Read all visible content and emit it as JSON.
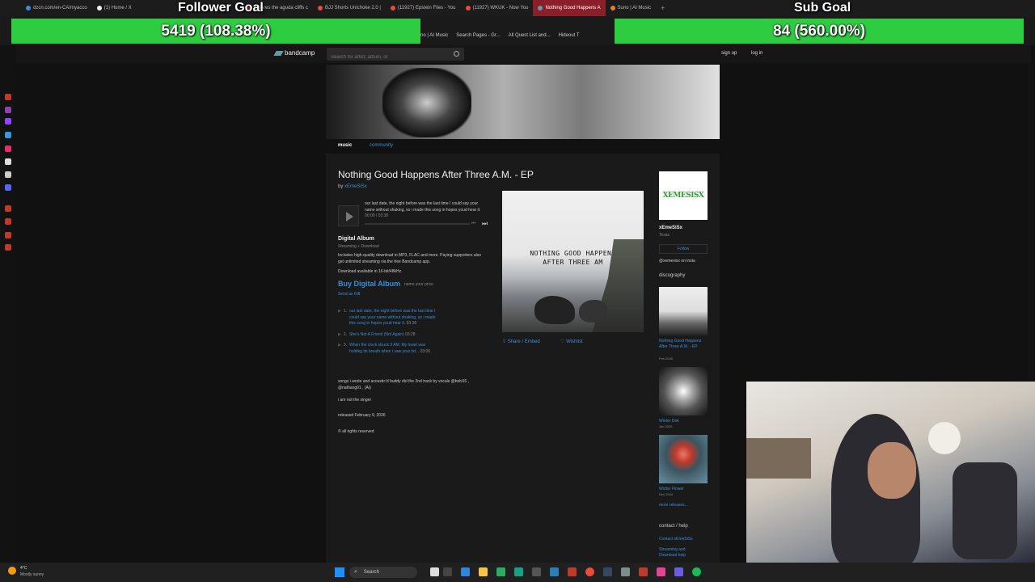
{
  "browser": {
    "tabs": [
      {
        "label": "dzcn.com/en-CA/myacco",
        "color": "#3a8fd9"
      },
      {
        "label": "(1) Home / X",
        "color": "#eee"
      },
      {
        "label": "Wheres the aguda cliffs c",
        "color": "#e74c3c"
      },
      {
        "label": "BJJ Shorts Unichoke 2.0 |",
        "color": "#e74c3c"
      },
      {
        "label": "(11927) Epstein Files - You",
        "color": "#e74c3c"
      },
      {
        "label": "(11927) WKUK - Now You",
        "color": "#e74c3c"
      },
      {
        "label": "Nothing Good Happens A",
        "color": "#629aa9",
        "active": true
      },
      {
        "label": "Suno | AI Music",
        "color": "#e67e22"
      }
    ],
    "bookmarks": [
      "no | AI Music",
      "Search Pages - Gr...",
      "All Quest List and...",
      "Hideout T"
    ]
  },
  "overlay": {
    "follower_title": "Follower Goal",
    "follower_value": "5419 (108.38%)",
    "follower_min": "0",
    "follower_max": "5000",
    "sub_title": "Sub Goal",
    "sub_value": "84 (560.00%)",
    "sub_min": "0",
    "sub_max": "15"
  },
  "bandcamp": {
    "logo": "bandcamp",
    "search_placeholder": "Search for artist, album, or",
    "sign_up": "sign up",
    "log_in": "log in",
    "nav": [
      "music",
      "community"
    ],
    "album_title": "Nothing Good Happens After Three A.M. - EP",
    "by_prefix": "by",
    "artist": "xEmeSiSx",
    "player_track": "our last date, the night before was the last time I could say your name without shaking, so i made this song in hopes youd hear it.",
    "player_time": "00:00 / 03:38",
    "digital_album": "Digital Album",
    "streaming": "Streaming + Download",
    "desc": "Includes high-quality download in MP3, FLAC and more. Paying supporters also get unlimited streaming via the free Bandcamp app.",
    "available": "Download available in 16-bit/48kHz.",
    "buy": "Buy Digital Album",
    "name_price": "name your price",
    "send_gift": "Send as Gift",
    "tracks": [
      {
        "num": "1.",
        "title": "our last date, the night before was the last time I could say your name without shaking, so i made this song in hopes youd hear it.",
        "time": "03:38"
      },
      {
        "num": "2.",
        "title": "She's Not A Friend (Not Again)",
        "time": "03:28"
      },
      {
        "num": "3.",
        "title": "When the clock struck 3 AM, My heart was holding its breath when i saw your txt...",
        "time": "03:06"
      }
    ],
    "about": "songs i wrote and acoustic'd buddy did the 2nd track by vocals @bobX6 , @nathang01 , (AI)",
    "not_singer": "i am not the singer",
    "released": "released February 9, 2026",
    "rights": "all rights reserved",
    "cover_text": "NOTHING GOOD HAPPENS AFTER THREE AM",
    "share": "Share / Embed",
    "wishlist": "Wishlist",
    "side": {
      "logo_text": "XEMESISX",
      "artist": "xEmeSiSx",
      "location": "Texas",
      "follow": "Follow",
      "insta": "@xemesisx on insta",
      "discography": "discography",
      "releases": [
        {
          "title": "Nothing Good Happens After Three A.M. - EP",
          "date": "Feb 2026"
        },
        {
          "title": "Winter Dek",
          "date": "Jan 2026"
        },
        {
          "title": "Winter Flower",
          "date": "Dec 2024"
        }
      ],
      "more": "more releases...",
      "contact_head": "contact / help",
      "contact": "Contact xEmeSiSx",
      "streaming_help": "Streaming and Download help"
    }
  },
  "taskbar": {
    "weather_temp": "4°C",
    "weather_desc": "Mostly sunny",
    "search": "Search"
  }
}
